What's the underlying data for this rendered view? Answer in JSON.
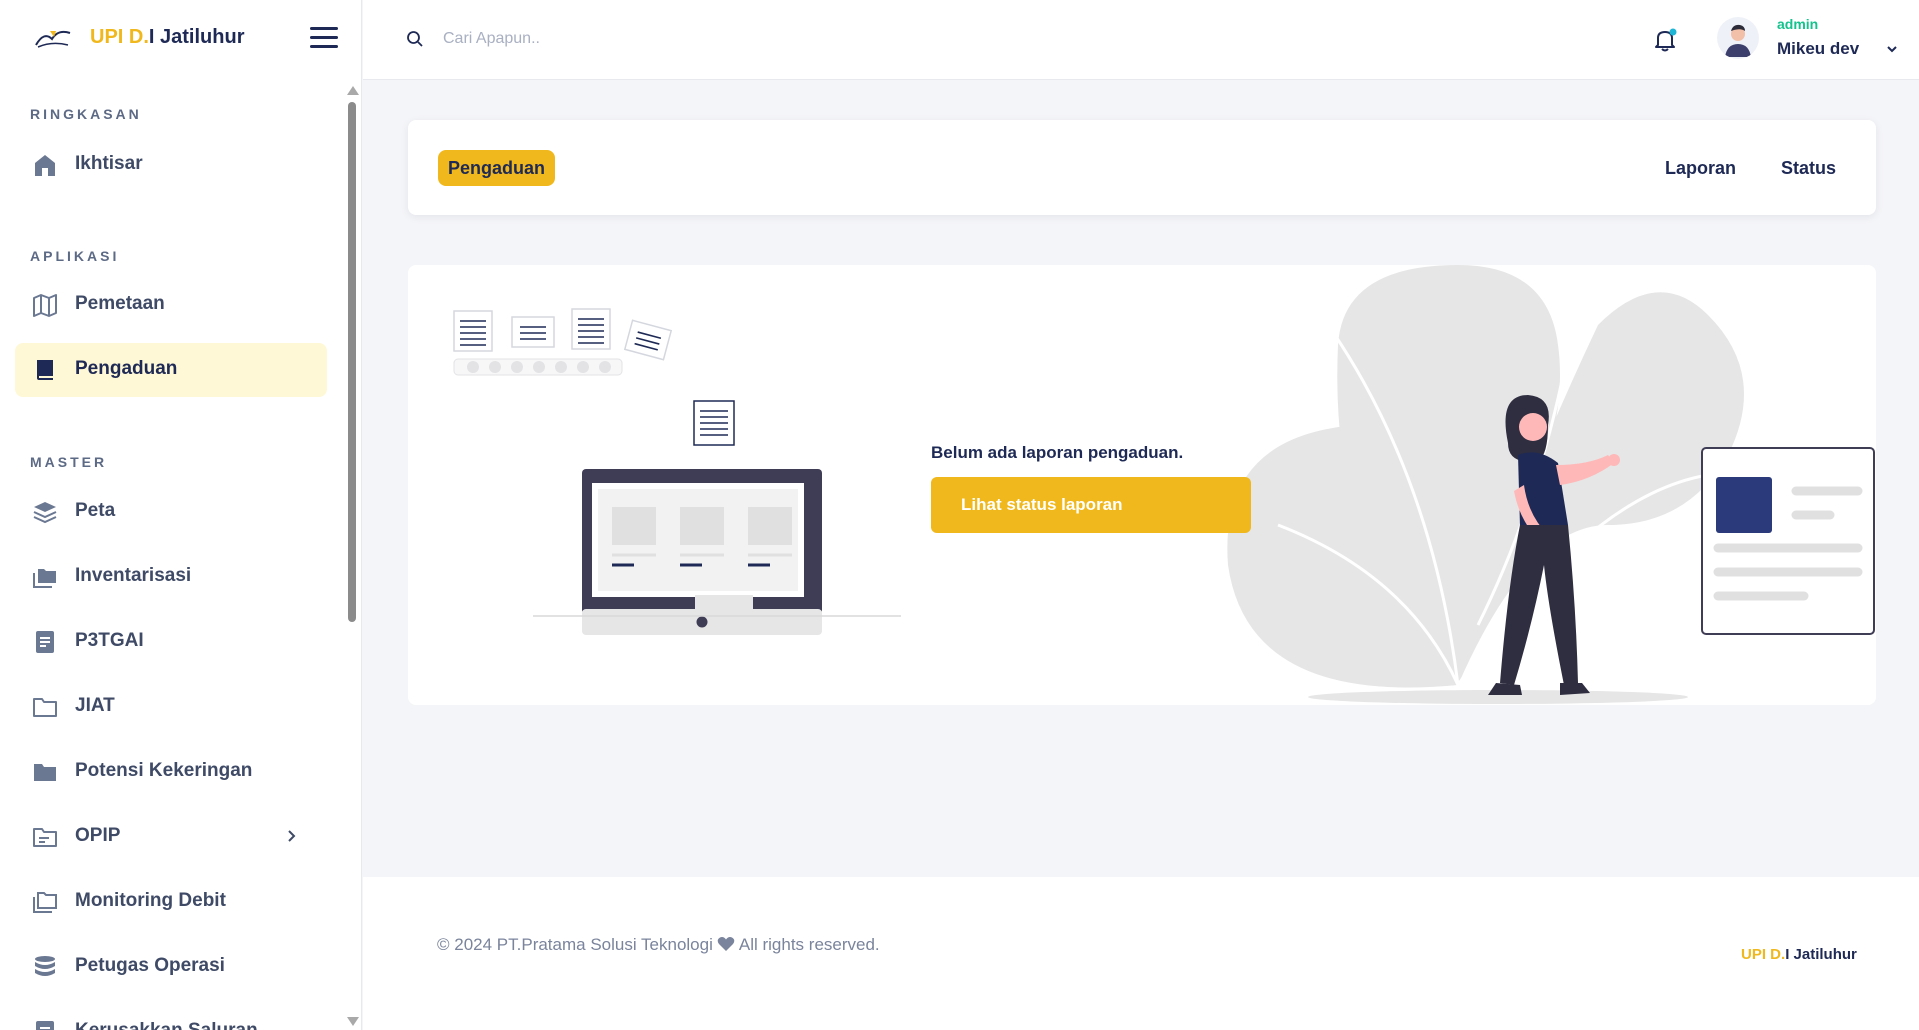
{
  "brand": {
    "name_part1": "UPI D.",
    "name_part2": "I Jatiluhur"
  },
  "sidebar": {
    "sections": [
      {
        "title": "RINGKASAN"
      },
      {
        "title": "APLIKASI"
      },
      {
        "title": "MASTER"
      }
    ],
    "items": [
      {
        "label": "Ikhtisar",
        "icon": "home-icon"
      },
      {
        "label": "Pemetaan",
        "icon": "map-icon"
      },
      {
        "label": "Pengaduan",
        "icon": "book-icon",
        "active": true
      },
      {
        "label": "Peta",
        "icon": "layers-icon"
      },
      {
        "label": "Inventarisasi",
        "icon": "folders-icon"
      },
      {
        "label": "P3TGAI",
        "icon": "document-icon"
      },
      {
        "label": "JIAT",
        "icon": "folder-icon"
      },
      {
        "label": "Potensi Kekeringan",
        "icon": "folder-filled-icon"
      },
      {
        "label": "OPIP",
        "icon": "folder-lines-icon",
        "has_submenu": true
      },
      {
        "label": "Monitoring Debit",
        "icon": "folders-outline-icon"
      },
      {
        "label": "Petugas Operasi",
        "icon": "database-icon"
      },
      {
        "label": "Kerusakkan Saluran",
        "icon": "document-icon"
      }
    ]
  },
  "header": {
    "search_placeholder": "Cari Apapun..",
    "user_role": "admin",
    "user_name": "Mikeu dev"
  },
  "tabs": {
    "active": "Pengaduan",
    "items": [
      "Laporan",
      "Status"
    ]
  },
  "empty_state": {
    "message": "Belum ada laporan pengaduan.",
    "button_label": "Lihat status laporan"
  },
  "footer": {
    "copyright_before": "© 2024 PT.Pratama Solusi Teknologi",
    "copyright_after": "All rights reserved.",
    "brand_part1": "UPI D.",
    "brand_part2": "I Jatiluhur"
  },
  "colors": {
    "accent": "#f0b81c",
    "navy": "#1e2a55",
    "active_bg": "#fff8d6",
    "role_green": "#14c28c"
  }
}
